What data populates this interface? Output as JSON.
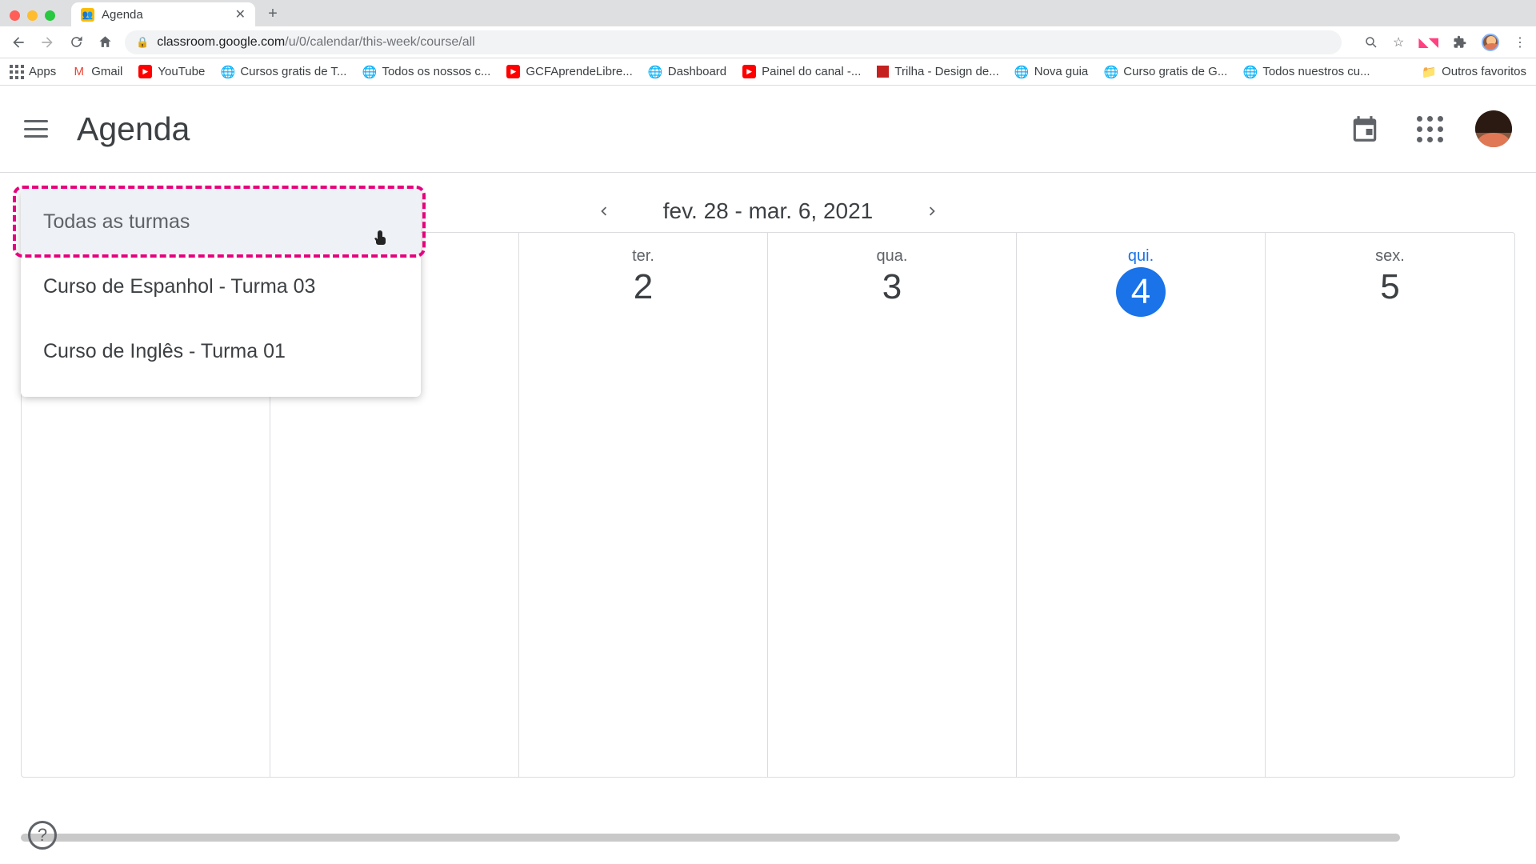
{
  "browser": {
    "tab_title": "Agenda",
    "url_domain": "classroom.google.com",
    "url_path": "/u/0/calendar/this-week/course/all",
    "bookmarks_label_apps": "Apps",
    "bookmarks": [
      {
        "label": "Gmail"
      },
      {
        "label": "YouTube"
      },
      {
        "label": "Cursos gratis de T..."
      },
      {
        "label": "Todos os nossos c..."
      },
      {
        "label": "GCFAprendeLibre..."
      },
      {
        "label": "Dashboard"
      },
      {
        "label": "Painel do canal -..."
      },
      {
        "label": "Trilha - Design de..."
      },
      {
        "label": "Nova guia"
      },
      {
        "label": "Curso gratis de G..."
      },
      {
        "label": "Todos nuestros cu..."
      }
    ],
    "other_bookmarks": "Outros favoritos"
  },
  "app": {
    "title": "Agenda"
  },
  "date_nav": {
    "range": "fev. 28 - mar. 6, 2021"
  },
  "dropdown": {
    "items": [
      {
        "label": "Todas as turmas",
        "selected": true
      },
      {
        "label": "Curso de Espanhol - Turma 03",
        "selected": false
      },
      {
        "label": "Curso de Inglês - Turma 01",
        "selected": false
      }
    ]
  },
  "calendar": {
    "days": [
      {
        "dow": "ter.",
        "num": "2",
        "today": false
      },
      {
        "dow": "qua.",
        "num": "3",
        "today": false
      },
      {
        "dow": "qui.",
        "num": "4",
        "today": true
      },
      {
        "dow": "sex.",
        "num": "5",
        "today": false
      }
    ]
  },
  "help_label": "?"
}
